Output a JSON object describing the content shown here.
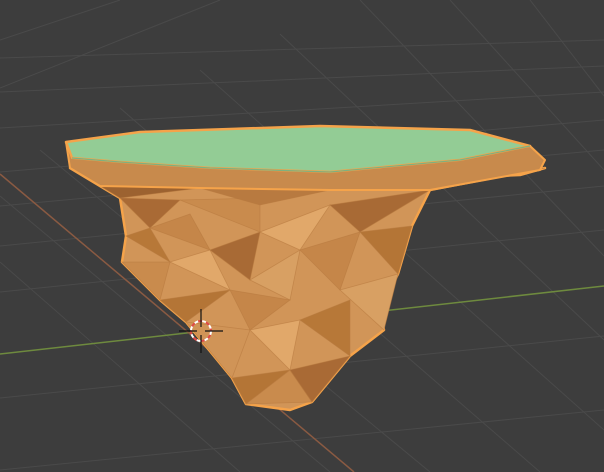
{
  "viewport": {
    "background_color": "#3d3d3d",
    "grid_color": "#4a4a4a",
    "x_axis_color": "#6e8a3e",
    "y_axis_color": "#8a5a42",
    "show_grid": true
  },
  "object": {
    "name": "",
    "type": "mesh",
    "description_icon": "floating-island-mesh",
    "selected": true,
    "selection_outline_color": "#f5a34a",
    "top_color": "#93cc95",
    "rock_base_color": "#d19558",
    "rock_shadow_color": "#a96a35",
    "rock_highlight_color": "#e1a86a"
  },
  "cursor_3d": {
    "icon": "3d-cursor-icon",
    "ring_color_a": "#ffffff",
    "ring_color_b": "#e04848",
    "crosshair_color": "#111111"
  }
}
